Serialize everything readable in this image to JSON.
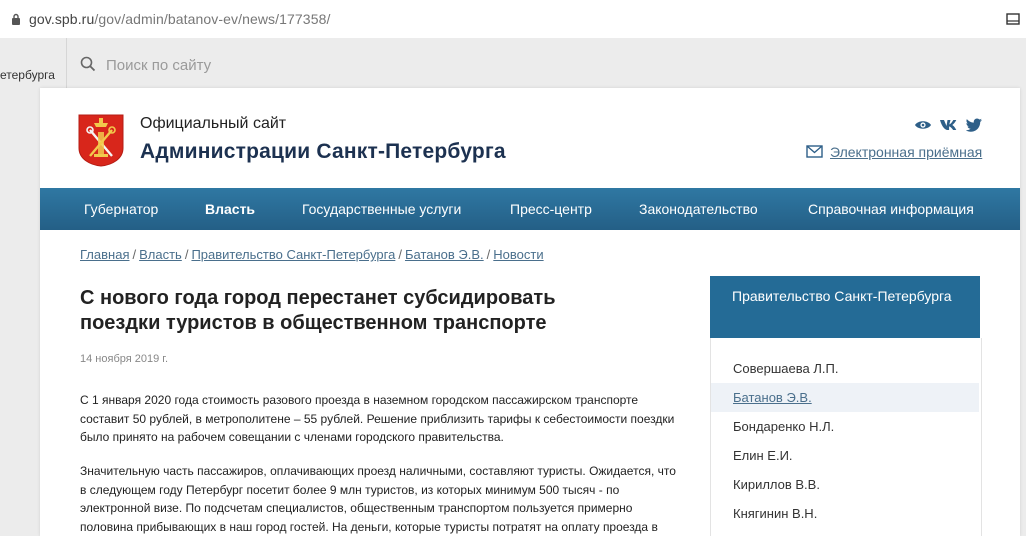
{
  "browser": {
    "url_domain": "gov.spb.ru",
    "url_path": "/gov/admin/batanov-ev/news/177358/"
  },
  "topstrip": {
    "left_fragment": "етербурга",
    "search_placeholder": "Поиск по сайту"
  },
  "header": {
    "subtitle": "Официальный сайт",
    "title": "Администрации Санкт-Петербурга",
    "reception_link": "Электронная приёмная",
    "social_icons": [
      "eye-icon",
      "vk-icon",
      "twitter-icon"
    ]
  },
  "nav": {
    "items": [
      {
        "label": "Губернатор"
      },
      {
        "label": "Власть"
      },
      {
        "label": "Государственные услуги"
      },
      {
        "label": "Пресс-центр"
      },
      {
        "label": "Законодательство"
      },
      {
        "label": "Справочная информация"
      }
    ],
    "active": "Власть"
  },
  "breadcrumb": {
    "items": [
      "Главная",
      "Власть",
      "Правительство Санкт-Петербурга",
      "Батанов Э.В.",
      "Новости"
    ],
    "separator": "/"
  },
  "article": {
    "title": "С нового года город перестанет субсидировать поездки туристов в общественном транспорте",
    "date": "14 ноября 2019 г.",
    "paragraphs": [
      "С 1 января 2020 года стоимость разового проезда в наземном городском пассажирском транспорте составит 50 рублей, в метрополитене – 55 рублей. Решение приблизить тарифы к себестоимости поездки было принято на рабочем совещании с членами городского правительства.",
      "Значительную часть пассажиров, оплачивающих проезд наличными, составляют туристы. Ожидается, что в следующем году Петербург посетит более 9 млн туристов, из которых минимум 500 тысяч - по электронной визе. По подсчетам специалистов, общественным транспортом пользуется примерно половина прибывающих в наш город гостей. На деньги, которые туристы потратят на оплату проезда в"
    ]
  },
  "sidebar": {
    "header": "Правительство Санкт-Петербурга",
    "items": [
      {
        "label": "Совершаева Л.П."
      },
      {
        "label": "Батанов Э.В."
      },
      {
        "label": "Бондаренко Н.Л."
      },
      {
        "label": "Елин Е.И."
      },
      {
        "label": "Кириллов В.В."
      },
      {
        "label": "Княгинин В.Н."
      }
    ],
    "active": "Батанов Э.В."
  },
  "colors": {
    "nav_bg": "#2a6c96",
    "sidebar_header_bg": "#246b96",
    "title_color": "#1c3150",
    "link_color": "#4a6f8c",
    "logo_red": "#d8261b"
  }
}
